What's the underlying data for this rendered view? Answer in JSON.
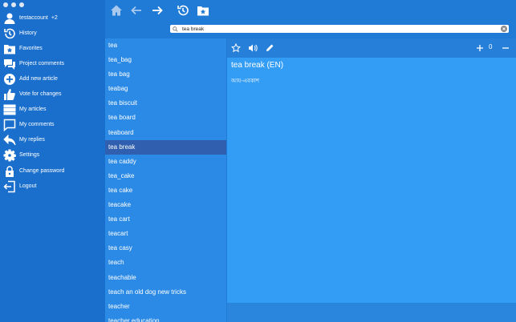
{
  "sidebar": {
    "account": {
      "name": "testaccount",
      "badge": "+2"
    },
    "items": [
      {
        "label": "History",
        "icon": "history-icon"
      },
      {
        "label": "Favorites",
        "icon": "favorites-icon"
      },
      {
        "label": "Project comments",
        "icon": "comments-icon"
      },
      {
        "label": "Add new article",
        "icon": "add-icon"
      },
      {
        "label": "Vote for changes",
        "icon": "vote-icon"
      },
      {
        "label": "My articles",
        "icon": "list-icon"
      },
      {
        "label": "My comments",
        "icon": "comment-icon"
      },
      {
        "label": "My replies",
        "icon": "reply-icon"
      },
      {
        "label": "Settings",
        "icon": "gear-icon"
      },
      {
        "label": "Change password",
        "icon": "lock-icon"
      },
      {
        "label": "Logout",
        "icon": "logout-icon"
      }
    ]
  },
  "search": {
    "value": "tea break"
  },
  "wordlist": {
    "words": [
      "tea",
      "tea_bag",
      "tea bag",
      "teabag",
      "tea biscuit",
      "tea board",
      "teaboard",
      "tea break",
      "tea caddy",
      "tea_cake",
      "tea cake",
      "teacake",
      "tea cart",
      "teacart",
      "tea casy",
      "teach",
      "teachable",
      "teach an old dog new tricks",
      "teacher",
      "teacher education"
    ],
    "selected": "tea break"
  },
  "article": {
    "title": "tea break (EN)",
    "body": "আয-এবকাশ",
    "vote_count": "0"
  },
  "colors": {
    "sidebar": "#1a6fcc",
    "selected": "#2f5fae",
    "article": "#339df5"
  }
}
